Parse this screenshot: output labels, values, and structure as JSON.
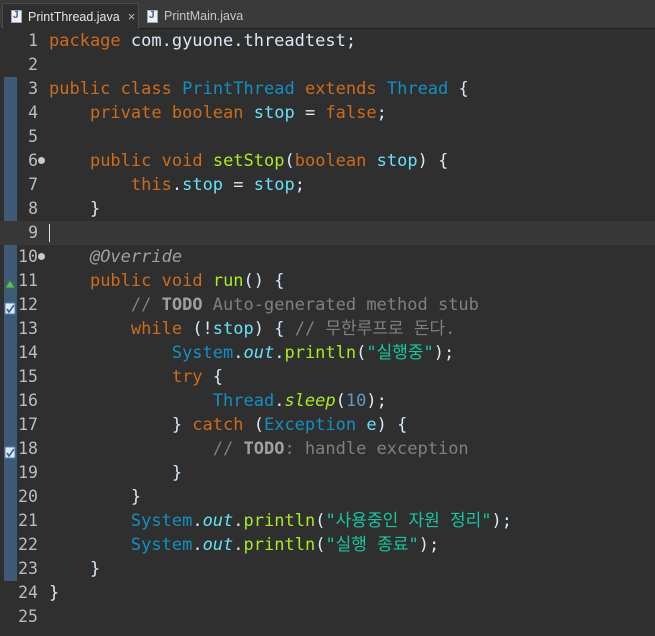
{
  "tabs": [
    {
      "label": "PrintThread.java",
      "active": true,
      "close": "×"
    },
    {
      "label": "PrintMain.java",
      "active": false
    }
  ],
  "colors": {
    "background": "#2f2f2f",
    "keyword": "#cc6c1d",
    "class": "#1290c3",
    "field": "#66e1f8",
    "method": "#a7ec21",
    "string": "#17c6a3",
    "number": "#6897bb",
    "comment": "#808080"
  },
  "cursor_line": 9,
  "lines": [
    {
      "n": "1",
      "tokens": [
        [
          "kw",
          "package"
        ],
        [
          "pln",
          " com.gyuone.threadtest;"
        ]
      ]
    },
    {
      "n": "2",
      "tokens": []
    },
    {
      "n": "3",
      "tokens": [
        [
          "kw",
          "public"
        ],
        [
          "pln",
          " "
        ],
        [
          "kw",
          "class"
        ],
        [
          "pln",
          " "
        ],
        [
          "cls",
          "PrintThread"
        ],
        [
          "pln",
          " "
        ],
        [
          "kw",
          "extends"
        ],
        [
          "pln",
          " "
        ],
        [
          "cls",
          "Thread"
        ],
        [
          "pln",
          " {"
        ]
      ]
    },
    {
      "n": "4",
      "tokens": [
        [
          "pln",
          "    "
        ],
        [
          "kw",
          "private"
        ],
        [
          "pln",
          " "
        ],
        [
          "kw",
          "boolean"
        ],
        [
          "pln",
          " "
        ],
        [
          "fld",
          "stop"
        ],
        [
          "pln",
          " = "
        ],
        [
          "kw",
          "false"
        ],
        [
          "pln",
          ";"
        ]
      ]
    },
    {
      "n": "5",
      "tokens": []
    },
    {
      "n": "6",
      "fold": true,
      "tokens": [
        [
          "pln",
          "    "
        ],
        [
          "kw",
          "public"
        ],
        [
          "pln",
          " "
        ],
        [
          "kw",
          "void"
        ],
        [
          "pln",
          " "
        ],
        [
          "mth",
          "setStop"
        ],
        [
          "pln",
          "("
        ],
        [
          "kw",
          "boolean"
        ],
        [
          "pln",
          " "
        ],
        [
          "fld",
          "stop"
        ],
        [
          "pln",
          ") {"
        ]
      ]
    },
    {
      "n": "7",
      "tokens": [
        [
          "pln",
          "        "
        ],
        [
          "kw",
          "this"
        ],
        [
          "pln",
          "."
        ],
        [
          "fld",
          "stop"
        ],
        [
          "pln",
          " = "
        ],
        [
          "fld",
          "stop"
        ],
        [
          "pln",
          ";"
        ]
      ]
    },
    {
      "n": "8",
      "tokens": [
        [
          "pln",
          "    }"
        ]
      ]
    },
    {
      "n": "9",
      "tokens": []
    },
    {
      "n": "10",
      "fold": true,
      "tokens": [
        [
          "pln",
          "    "
        ],
        [
          "ann",
          "@Override"
        ]
      ]
    },
    {
      "n": "11",
      "marker": "override-triangle-icon",
      "tokens": [
        [
          "pln",
          "    "
        ],
        [
          "kw",
          "public"
        ],
        [
          "pln",
          " "
        ],
        [
          "kw",
          "void"
        ],
        [
          "pln",
          " "
        ],
        [
          "mth",
          "run"
        ],
        [
          "pln",
          "() {"
        ]
      ]
    },
    {
      "n": "12",
      "marker": "task-marker-icon",
      "tokens": [
        [
          "pln",
          "        "
        ],
        [
          "cmt",
          "// "
        ],
        [
          "tag",
          "TODO"
        ],
        [
          "cmt",
          " Auto-generated method stub"
        ]
      ]
    },
    {
      "n": "13",
      "tokens": [
        [
          "pln",
          "        "
        ],
        [
          "kw",
          "while"
        ],
        [
          "pln",
          " (!"
        ],
        [
          "fld",
          "stop"
        ],
        [
          "pln",
          ") { "
        ],
        [
          "cmt",
          "// 무한루프로 돈다."
        ]
      ]
    },
    {
      "n": "14",
      "tokens": [
        [
          "pln",
          "            "
        ],
        [
          "cls",
          "System"
        ],
        [
          "pln",
          "."
        ],
        [
          "fld ital",
          "out"
        ],
        [
          "pln",
          "."
        ],
        [
          "mth",
          "println"
        ],
        [
          "pln",
          "("
        ],
        [
          "str",
          "\"실행중\""
        ],
        [
          "pln",
          ");"
        ]
      ]
    },
    {
      "n": "15",
      "tokens": [
        [
          "pln",
          "            "
        ],
        [
          "kw",
          "try"
        ],
        [
          "pln",
          " {"
        ]
      ]
    },
    {
      "n": "16",
      "tokens": [
        [
          "pln",
          "                "
        ],
        [
          "cls",
          "Thread"
        ],
        [
          "pln",
          "."
        ],
        [
          "mth ital",
          "sleep"
        ],
        [
          "pln",
          "("
        ],
        [
          "num",
          "10"
        ],
        [
          "pln",
          ");"
        ]
      ]
    },
    {
      "n": "17",
      "tokens": [
        [
          "pln",
          "            } "
        ],
        [
          "kw",
          "catch"
        ],
        [
          "pln",
          " ("
        ],
        [
          "cls",
          "Exception"
        ],
        [
          "pln",
          " "
        ],
        [
          "fld",
          "e"
        ],
        [
          "pln",
          ") {"
        ]
      ]
    },
    {
      "n": "18",
      "marker": "task-marker-icon",
      "tokens": [
        [
          "pln",
          "                "
        ],
        [
          "cmt",
          "// "
        ],
        [
          "tag",
          "TODO"
        ],
        [
          "cmt",
          ": handle exception"
        ]
      ]
    },
    {
      "n": "19",
      "tokens": [
        [
          "pln",
          "            }"
        ]
      ]
    },
    {
      "n": "20",
      "tokens": [
        [
          "pln",
          "        }"
        ]
      ]
    },
    {
      "n": "21",
      "tokens": [
        [
          "pln",
          "        "
        ],
        [
          "cls",
          "System"
        ],
        [
          "pln",
          "."
        ],
        [
          "fld ital",
          "out"
        ],
        [
          "pln",
          "."
        ],
        [
          "mth",
          "println"
        ],
        [
          "pln",
          "("
        ],
        [
          "str",
          "\"사용중인 자원 정리\""
        ],
        [
          "pln",
          ");"
        ]
      ]
    },
    {
      "n": "22",
      "tokens": [
        [
          "pln",
          "        "
        ],
        [
          "cls",
          "System"
        ],
        [
          "pln",
          "."
        ],
        [
          "fld ital",
          "out"
        ],
        [
          "pln",
          "."
        ],
        [
          "mth",
          "println"
        ],
        [
          "pln",
          "("
        ],
        [
          "str",
          "\"실행 종료\""
        ],
        [
          "pln",
          ");"
        ]
      ]
    },
    {
      "n": "23",
      "tokens": [
        [
          "pln",
          "    }"
        ]
      ]
    },
    {
      "n": "24",
      "tokens": [
        [
          "pln",
          "}"
        ]
      ]
    },
    {
      "n": "25",
      "tokens": []
    }
  ]
}
